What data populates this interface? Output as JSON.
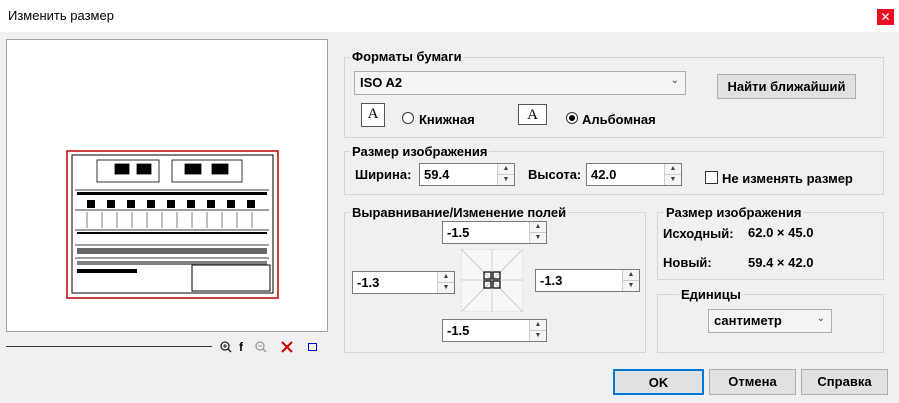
{
  "window": {
    "title": "Изменить размер",
    "close_glyph": "✕"
  },
  "paper": {
    "group_label": "Форматы бумаги",
    "format_value": "ISO A2",
    "find_nearest_label": "Найти ближайший",
    "portrait_label": "Книжная",
    "landscape_label": "Альбомная",
    "portrait_icon_letter": "A",
    "landscape_icon_letter": "A",
    "orientation_selected": "landscape"
  },
  "image_size": {
    "group_label": "Размер изображения",
    "width_label": "Ширина:",
    "width_value": "59.4",
    "height_label": "Высота:",
    "height_value": "42.0",
    "keep_size_label": "Не изменять размер",
    "keep_size_checked": false
  },
  "margins": {
    "group_label": "Выравнивание/Изменение полей",
    "top_value": "-1.5",
    "left_value": "-1.3",
    "right_value": "-1.3",
    "bottom_value": "-1.5"
  },
  "size_info": {
    "group_label": "Размер изображения",
    "original_label": "Исходный:",
    "original_value": "62.0 × 45.0",
    "new_label": "Новый:",
    "new_value": "59.4 × 42.0"
  },
  "units": {
    "group_label": "Единицы",
    "value": "сантиметр"
  },
  "preview_toolbar": {
    "zoom_in_icon": "zoom-in-icon",
    "fit_label": "f",
    "zoom_out_icon": "zoom-out-icon",
    "delete_icon": "delete-icon",
    "frame_icon": "frame-icon"
  },
  "buttons": {
    "ok_label": "OK",
    "cancel_label": "Отмена",
    "help_label": "Справка"
  },
  "colors": {
    "close_bg": "#e81123",
    "delete_red": "#cc0000",
    "frame_blue": "#0000cc",
    "preview_border_red": "#c00000"
  }
}
